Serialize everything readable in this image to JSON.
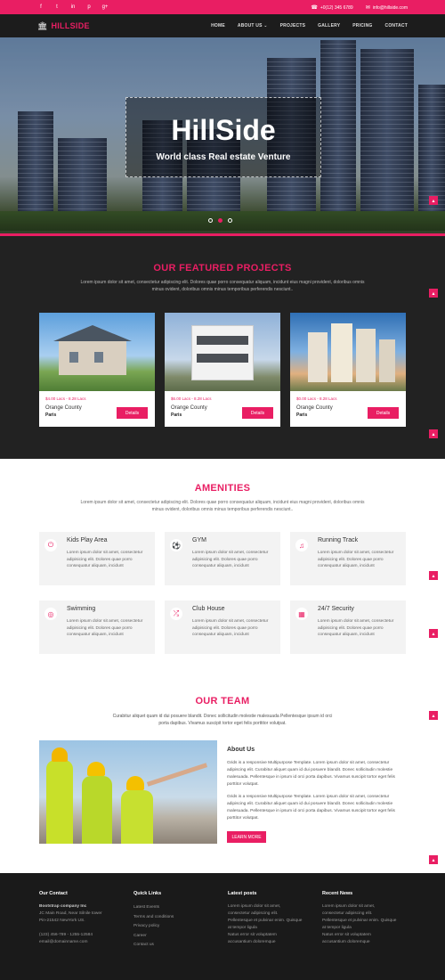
{
  "topbar": {
    "socials": [
      {
        "icon": "facebook-icon",
        "glyph": "f"
      },
      {
        "icon": "twitter-icon",
        "glyph": "t"
      },
      {
        "icon": "linkedin-icon",
        "glyph": "in"
      },
      {
        "icon": "pinterest-icon",
        "glyph": "p"
      },
      {
        "icon": "google-plus-icon",
        "glyph": "g+"
      }
    ],
    "phone": "+0(12) 345 6789",
    "email": "info@hillside.com"
  },
  "nav": {
    "logo": "HILLSIDE",
    "items": [
      "HOME",
      "ABOUT US ⌄",
      "PROJECTS",
      "GALLERY",
      "PRICING",
      "CONTACT"
    ]
  },
  "hero": {
    "title": "HillSide",
    "subtitle": "World class Real estate Venture",
    "slides": 3,
    "active_slide": 1
  },
  "featured": {
    "title": "OUR FEATURED PROJECTS",
    "desc": "Lorem ipsum dolor sit amet, consectetur adipiscing elit. Dolores quae porro consequatur aliquam, incidunt eius magni provident, doloribus omnis minus ovident, doloribus omnis minus temporibus perferendis nesciunt..",
    "cards": [
      {
        "price": "$4.00 Lacs - 8.28 Lacs",
        "county": "Orange County",
        "city": "Paris",
        "button": "Details"
      },
      {
        "price": "$6.00 Lacs - 8.28 Lacs",
        "county": "Orange County",
        "city": "Paris",
        "button": "Details"
      },
      {
        "price": "$0.00 Lacs - 8.28 Lacs",
        "county": "Orange County",
        "city": "Paris",
        "button": "Details"
      }
    ]
  },
  "amenities": {
    "title": "AMENITIES",
    "desc": "Lorem ipsum dolor sit amet, consectetur adipiscing elit. Dolores quae porro consequatur aliquam, incidunt eius magni provident, doloribus omnis minus ovident, doloribus omnis minus temporibus perferendis nesciunt..",
    "items": [
      {
        "icon": "power-icon",
        "glyph": "⏻",
        "title": "Kids Play Area",
        "text": "Lorem ipsum dolor sit amet, consectetur adipisicing elit. Dolores quae porro consequatur aliquam, incidunt"
      },
      {
        "icon": "soccer-ball-icon",
        "glyph": "⚽",
        "title": "GYM",
        "text": "Lorem ipsum dolor sit amet, consectetur adipisicing elit. Dolores quae porro consequatur aliquam, incidunt"
      },
      {
        "icon": "music-note-icon",
        "glyph": "♫",
        "title": "Running Track",
        "text": "Lorem ipsum dolor sit amet, consectetur adipisicing elit. Dolores quae porro consequatur aliquam, incidunt"
      },
      {
        "icon": "target-icon",
        "glyph": "◎",
        "title": "Swimming",
        "text": "Lorem ipsum dolor sit amet, consectetur adipisicing elit. Dolores quae porro consequatur aliquam, incidunt"
      },
      {
        "icon": "shuffle-icon",
        "glyph": "⤮",
        "title": "Club House",
        "text": "Lorem ipsum dolor sit amet, consectetur adipisicing elit. Dolores quae porro consequatur aliquam, incidunt"
      },
      {
        "icon": "security-icon",
        "glyph": "▦",
        "title": "24/7 Security",
        "text": "Lorem ipsum dolor sit amet, consectetur adipisicing elit. Dolores quae porro consequatur aliquam, incidunt"
      }
    ]
  },
  "team": {
    "title": "OUR TEAM",
    "desc": "Curabitur aliquet quam id dui posuere blandit. Donec sollicitudin molestie malesuada Pellentesque ipsum id orci porta dapibus. Vivamus suscipit tortor eget felis porttitor volutpat.",
    "about_title": "About Us",
    "about_p1": "Grids is a responsive Multipurpose Template. Lorem ipsum dolor sit amet, consectetur adipiscing elit. Curabitur aliquet quam id dui posuere blandit. Donec sollicitudin molestie malesuada. Pellentesque in ipsum id orci porta dapibus. Vivamus suscipit tortor eget felis porttitor volutpat.",
    "about_p2": "Grids is a responsive Multipurpose Template. Lorem ipsum dolor sit amet, consectetur adipiscing elit. Curabitur aliquet quam id dui posuere blandit. Donec sollicitudin molestie malesuada. Pellentesque in ipsum id orci porta dapibus. Vivamus suscipit tortor eget felis porttitor volutpat.",
    "button": "LEARN MORE"
  },
  "footer": {
    "contact": {
      "title": "Our Contact",
      "company": "Bootstrap company Inc",
      "address1": "JC Main Road, Near Silnile tower",
      "address2": "Pin-21542 NewYork US.",
      "phone": "(123) 456-789 - 1255-12584",
      "email": "email@domainname.com"
    },
    "quick_links": {
      "title": "Quick Links",
      "items": [
        "Latest Events",
        "Terms and conditions",
        "Privacy policy",
        "Career",
        "Contact us"
      ]
    },
    "latest_posts": {
      "title": "Latest posts",
      "lines": [
        "Lorem ipsum dolor sit amet,",
        "consectetur adipiscing elit.",
        "Pellentesque et pulvinar enim. Quisque",
        "at tempor ligula",
        "Natus error sit voluptatem",
        "accusantium doloremque"
      ]
    },
    "recent_news": {
      "title": "Recent News",
      "lines": [
        "Lorem ipsum dolor sit amet,",
        "consectetur adipiscing elit.",
        "Pellentesque et pulvinar enim. Quisque",
        "at tempor ligula",
        "Natus error sit voluptatem",
        "accusantium doloremque"
      ]
    }
  },
  "colors": {
    "accent": "#e91e63",
    "dark": "#222222",
    "tile": "#f3f3f3"
  }
}
